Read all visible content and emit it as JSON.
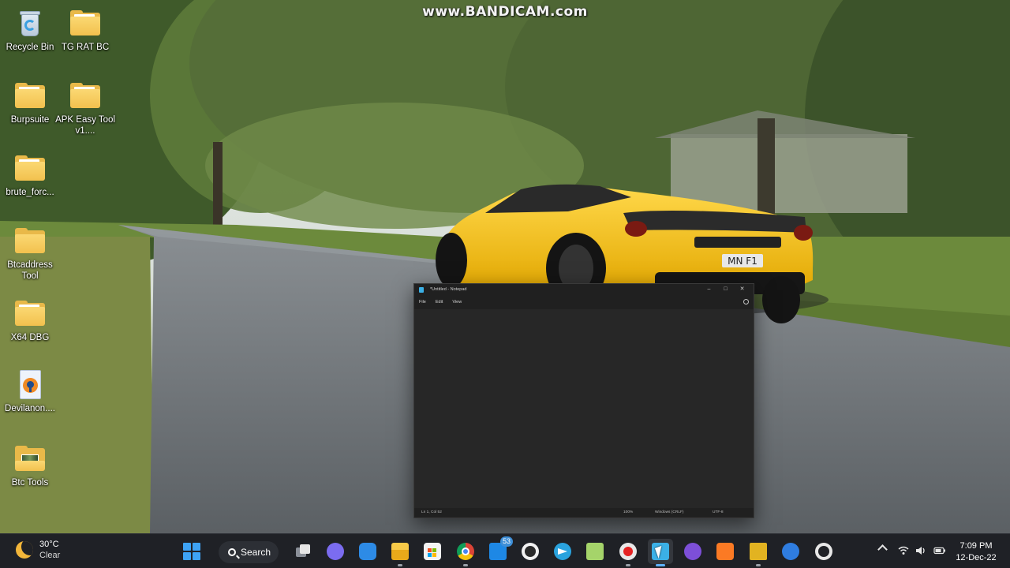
{
  "watermark": "www.BANDICAM.com",
  "desktop": {
    "icons": [
      {
        "label": "Recycle Bin"
      },
      {
        "label": "TG RAT BC"
      },
      {
        "label": "Burpsuite"
      },
      {
        "label": "APK Easy Tool v1...."
      },
      {
        "label": "brute_forc..."
      },
      {
        "label": "Btcaddress Tool"
      },
      {
        "label": "X64 DBG"
      },
      {
        "label": "Devilanon...."
      },
      {
        "label": "Btc Tools"
      }
    ]
  },
  "notepad": {
    "title": "*Untitled - Notepad",
    "controls": {
      "minimize": "–",
      "maximize": "□",
      "close": "✕"
    },
    "menu": [
      "File",
      "Edit",
      "View"
    ],
    "content": "",
    "status": {
      "position": "Ln 1, Col 52",
      "zoom": "100%",
      "line_endings": "Windows (CRLF)",
      "encoding": "UTF-8"
    }
  },
  "taskbar": {
    "weather": {
      "temperature": "30°C",
      "condition": "Clear"
    },
    "search_label": "Search",
    "mail_badge": "53",
    "apps": [
      "start-icon",
      "search-button",
      "task-view-icon",
      "teams-chat-icon",
      "app-blue-icon",
      "file-explorer-icon",
      "microsoft-store-icon",
      "chrome-icon",
      "mail-icon",
      "word-icon",
      "telegram-icon",
      "notepad-plus-icon",
      "record-icon",
      "notepad-icon",
      "tor-browser-icon",
      "xampp-icon",
      "network-tool-icon",
      "app-launcher-icon",
      "obs-icon"
    ],
    "clock": {
      "time": "7:09 PM",
      "date": "12-Dec-22"
    }
  }
}
